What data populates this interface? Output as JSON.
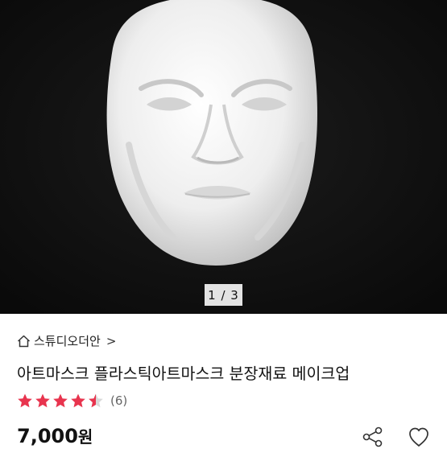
{
  "gallery": {
    "page_indicator": "1 / 3",
    "current": 1,
    "total": 3
  },
  "store": {
    "name": "스튜디오더안",
    "home_icon": "home-icon",
    "chevron": ">"
  },
  "product": {
    "title": "아트마스크 플라스틱아트마스크 분장재료 메이크업",
    "rating": 4.5,
    "review_count": "(6)",
    "price": "7,000",
    "currency": "원"
  },
  "actions": {
    "share_icon": "share-icon",
    "like_icon": "heart-icon"
  },
  "colors": {
    "star": "#e8344e",
    "star_empty": "#d9d9d9",
    "hero_bg": "#111111"
  }
}
